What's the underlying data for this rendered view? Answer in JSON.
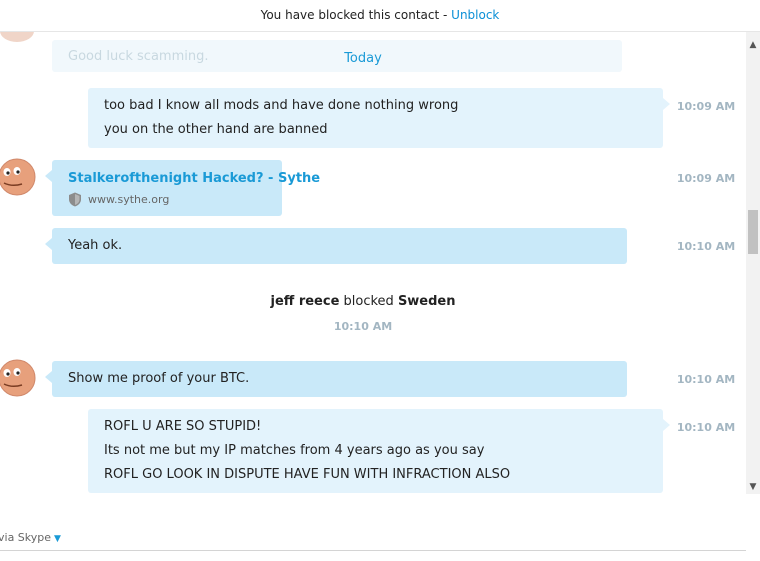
{
  "blocked_bar": {
    "text": "You have blocked this contact - ",
    "unblock_label": "Unblock"
  },
  "faded_message": "Good luck scamming.",
  "day_divider": "Today",
  "messages": [
    {
      "lines": [
        "too bad I know all mods and have done nothing wrong",
        "you on the other hand are banned"
      ],
      "time": "10:09 AM"
    },
    {
      "link_title": "Stalkerofthenight Hacked? - Sythe",
      "link_url": "www.sythe.org",
      "time": "10:09 AM"
    },
    {
      "lines": [
        "Yeah ok."
      ],
      "time": "10:10 AM"
    },
    {
      "lines": [
        "Show me proof of your BTC."
      ],
      "time": "10:10 AM"
    },
    {
      "lines": [
        "ROFL U ARE SO STUPID!",
        "Its not me but my IP matches from 4 years ago as you say",
        "ROFL GO LOOK IN DISPUTE HAVE FUN WITH INFRACTION ALSO"
      ],
      "time": "10:10 AM"
    }
  ],
  "system_event": {
    "actor": "jeff reece",
    "action": " blocked ",
    "target": "Sweden",
    "time": "10:10 AM"
  },
  "footer": {
    "via_label": "via Skype"
  },
  "colors": {
    "accent": "#1a9ad6",
    "own_bubble": "#e3f3fc",
    "other_bubble": "#c9e9f9",
    "timestamp": "#a3b6c2"
  }
}
